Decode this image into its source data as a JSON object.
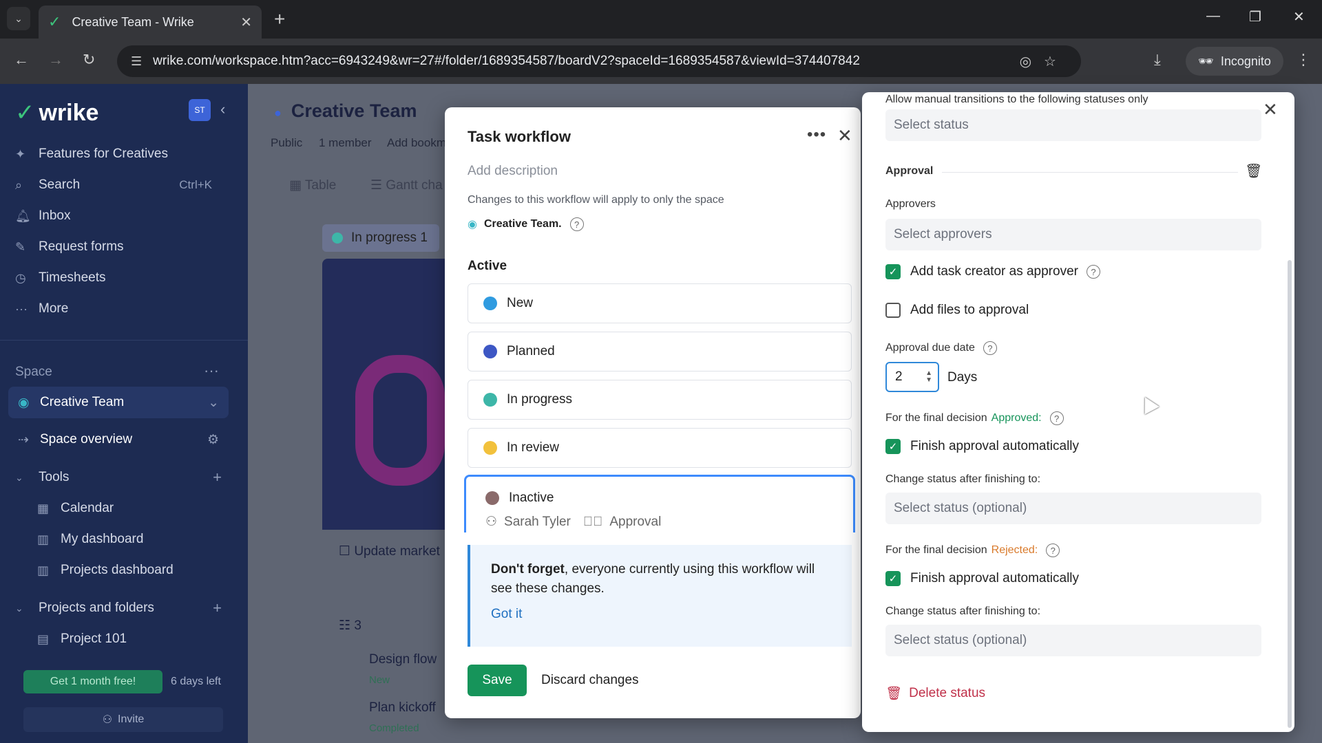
{
  "browser": {
    "tab_title": "Creative Team - Wrike",
    "url": "wrike.com/workspace.htm?acc=6943249&wr=27#/folder/1689354587/boardV2?spaceId=1689354587&viewId=374407842",
    "incognito_label": "Incognito"
  },
  "sidebar": {
    "logo": "wrike",
    "avatar_initials": "ST",
    "nav": [
      {
        "label": "Features for Creatives",
        "icon": "sparkle-icon"
      },
      {
        "label": "Search",
        "icon": "search-icon",
        "shortcut": "Ctrl+K"
      },
      {
        "label": "Inbox",
        "icon": "bell-icon"
      },
      {
        "label": "Request forms",
        "icon": "form-icon"
      },
      {
        "label": "Timesheets",
        "icon": "clock-icon"
      },
      {
        "label": "More",
        "icon": "dots-icon"
      }
    ],
    "space_label": "Space",
    "space_name": "Creative Team",
    "space_overview": "Space overview",
    "tools_label": "Tools",
    "tools": [
      "Calendar",
      "My dashboard",
      "Projects dashboard"
    ],
    "projects_label": "Projects and folders",
    "projects": [
      "Project 101"
    ],
    "promo": "Get 1 month free!",
    "days_left": "6 days left",
    "invite": "Invite"
  },
  "main": {
    "title": "Creative Team",
    "meta": [
      "Public",
      "1 member",
      "Add bookm"
    ],
    "views": [
      "Table",
      "Gantt cha"
    ],
    "column": "In progress 1",
    "tasks": [
      {
        "title": "Update market"
      },
      {
        "title": "Design flow",
        "status": "New"
      },
      {
        "title": "Plan kickoff",
        "status": "Completed"
      }
    ],
    "count": "3"
  },
  "modal": {
    "title": "Task workflow",
    "description_placeholder": "Add description",
    "note": "Changes to this workflow will apply to only the space",
    "space": "Creative Team.",
    "active_label": "Active",
    "statuses": [
      {
        "name": "New",
        "color": "#2f9be0"
      },
      {
        "name": "Planned",
        "color": "#3d57c4"
      },
      {
        "name": "In progress",
        "color": "#3db6a8"
      },
      {
        "name": "In review",
        "color": "#f2c13c"
      }
    ],
    "selected_status": {
      "name": "Inactive",
      "color": "#8a6a6a",
      "assignee": "Sarah Tyler",
      "approval": "Approval"
    },
    "info_bold": "Don't forget",
    "info_text": ", everyone currently using this workflow will see these changes.",
    "info_link": "Got it",
    "save": "Save",
    "discard": "Discard changes"
  },
  "panel": {
    "transitions_label": "Allow manual transitions to the following statuses only",
    "transitions_placeholder": "Select status",
    "section": "Approval",
    "approvers_label": "Approvers",
    "approvers_placeholder": "Select approvers",
    "add_creator": "Add task creator as approver",
    "add_files": "Add files to approval",
    "due_label": "Approval due date",
    "due_value": "2",
    "due_unit": "Days",
    "approved_prefix": "For the final decision",
    "approved_word": "Approved:",
    "finish_auto": "Finish approval automatically",
    "change_status_label": "Change status after finishing to:",
    "optional_placeholder": "Select status (optional)",
    "rejected_word": "Rejected:",
    "delete_status": "Delete status"
  }
}
